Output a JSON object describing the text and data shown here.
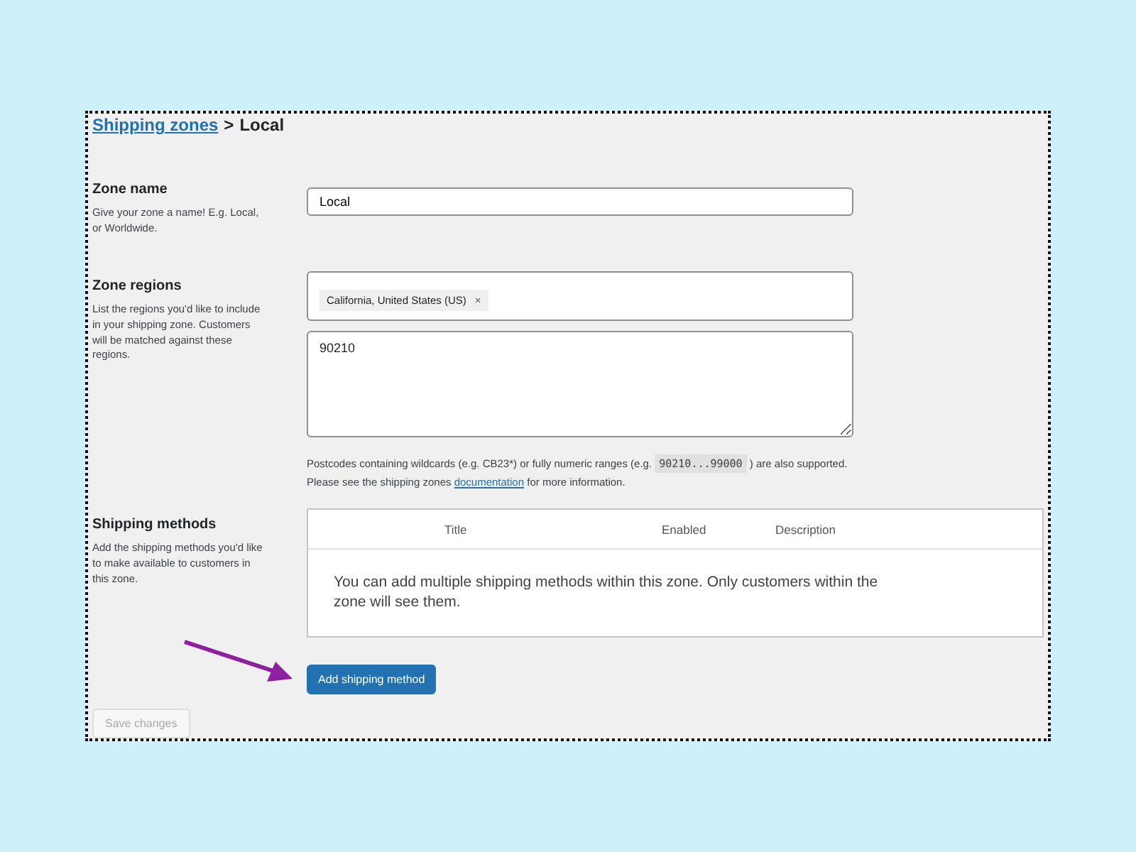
{
  "breadcrumb": {
    "link": "Shipping zones",
    "separator": ">",
    "current": "Local"
  },
  "zone_name": {
    "label": "Zone name",
    "description": "Give your zone a name! E.g. Local, or Worldwide.",
    "value": "Local"
  },
  "zone_regions": {
    "label": "Zone regions",
    "description": "List the regions you'd like to include in your shipping zone. Customers will be matched against these regions.",
    "tags": [
      {
        "label": "California, United States (US)",
        "remove": "×"
      }
    ],
    "postcodes": "90210",
    "help": {
      "before": "Postcodes containing wildcards (e.g. CB23*) or fully numeric ranges (e.g.",
      "code": "90210...99000",
      "after": ") are also supported. Please see the shipping zones",
      "link": "documentation",
      "end": "for more information."
    }
  },
  "shipping_methods": {
    "label": "Shipping methods",
    "description": "Add the shipping methods you'd like to make available to customers in this zone.",
    "columns": [
      "Title",
      "Enabled",
      "Description"
    ],
    "empty_message": "You can add multiple shipping methods within this zone. Only customers within the zone will see them."
  },
  "add_button": {
    "label": "Add shipping method"
  },
  "save_button": {
    "label": "Save changes",
    "disabled": true
  }
}
